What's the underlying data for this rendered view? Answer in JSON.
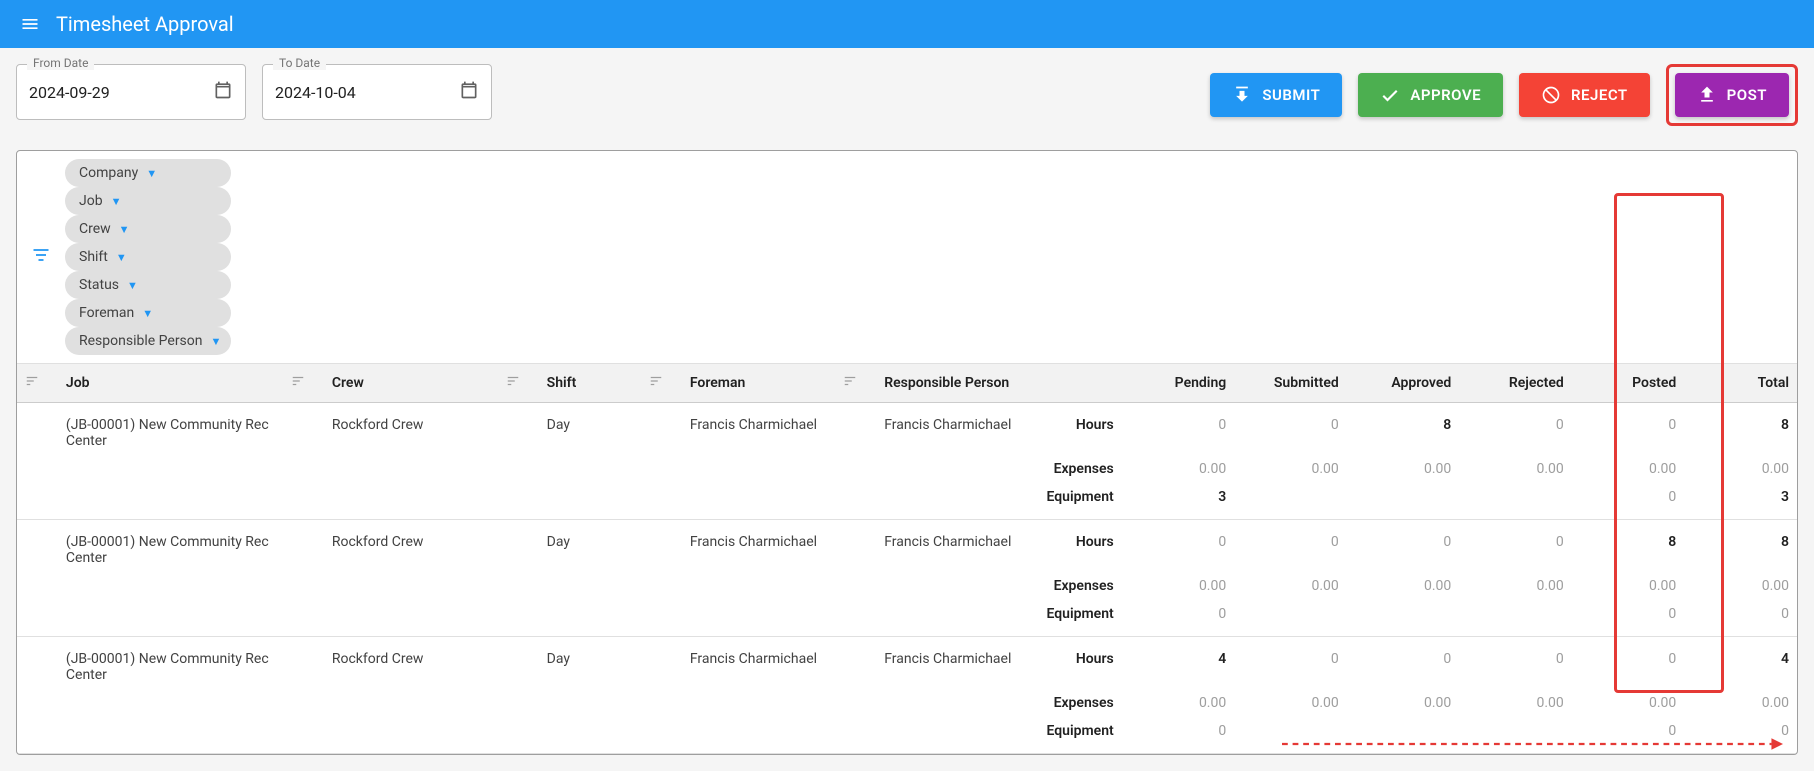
{
  "header": {
    "title": "Timesheet Approval"
  },
  "filters": {
    "from": {
      "label": "From Date",
      "value": "2024-09-29"
    },
    "to": {
      "label": "To Date",
      "value": "2024-10-04"
    }
  },
  "actions": {
    "submit": "SUBMIT",
    "approve": "APPROVE",
    "reject": "REJECT",
    "post": "POST"
  },
  "chips": [
    "Company",
    "Job",
    "Crew",
    "Shift",
    "Status",
    "Foreman",
    "Responsible Person"
  ],
  "columns": {
    "job": "Job",
    "crew": "Crew",
    "shift": "Shift",
    "foreman": "Foreman",
    "resp": "Responsible Person",
    "pending": "Pending",
    "submitted": "Submitted",
    "approved": "Approved",
    "rejected": "Rejected",
    "posted": "Posted",
    "total": "Total"
  },
  "metrics": {
    "hours": "Hours",
    "expenses": "Expenses",
    "equipment": "Equipment"
  },
  "rows": [
    {
      "job": "(JB-00001) New Community Rec Center",
      "crew": "Rockford Crew",
      "shift": "Day",
      "foreman": "Francis Charmichael",
      "resp": "Francis Charmichael",
      "hours": {
        "pending": "0",
        "submitted": "0",
        "approved": "8",
        "rejected": "0",
        "posted": "0",
        "total": "8"
      },
      "expenses": {
        "pending": "0.00",
        "submitted": "0.00",
        "approved": "0.00",
        "rejected": "0.00",
        "posted": "0.00",
        "total": "0.00"
      },
      "equipment": {
        "pending": "3",
        "submitted": "",
        "approved": "",
        "rejected": "",
        "posted": "0",
        "total": "3"
      }
    },
    {
      "job": "(JB-00001) New Community Rec Center",
      "crew": "Rockford Crew",
      "shift": "Day",
      "foreman": "Francis Charmichael",
      "resp": "Francis Charmichael",
      "hours": {
        "pending": "0",
        "submitted": "0",
        "approved": "0",
        "rejected": "0",
        "posted": "8",
        "total": "8"
      },
      "expenses": {
        "pending": "0.00",
        "submitted": "0.00",
        "approved": "0.00",
        "rejected": "0.00",
        "posted": "0.00",
        "total": "0.00"
      },
      "equipment": {
        "pending": "0",
        "submitted": "",
        "approved": "",
        "rejected": "",
        "posted": "0",
        "total": "0"
      }
    },
    {
      "job": "(JB-00001) New Community Rec Center",
      "crew": "Rockford Crew",
      "shift": "Day",
      "foreman": "Francis Charmichael",
      "resp": "Francis Charmichael",
      "hours": {
        "pending": "4",
        "submitted": "0",
        "approved": "0",
        "rejected": "0",
        "posted": "0",
        "total": "4"
      },
      "expenses": {
        "pending": "0.00",
        "submitted": "0.00",
        "approved": "0.00",
        "rejected": "0.00",
        "posted": "0.00",
        "total": "0.00"
      },
      "equipment": {
        "pending": "0",
        "submitted": "",
        "approved": "",
        "rejected": "",
        "posted": "0",
        "total": "0"
      }
    }
  ]
}
